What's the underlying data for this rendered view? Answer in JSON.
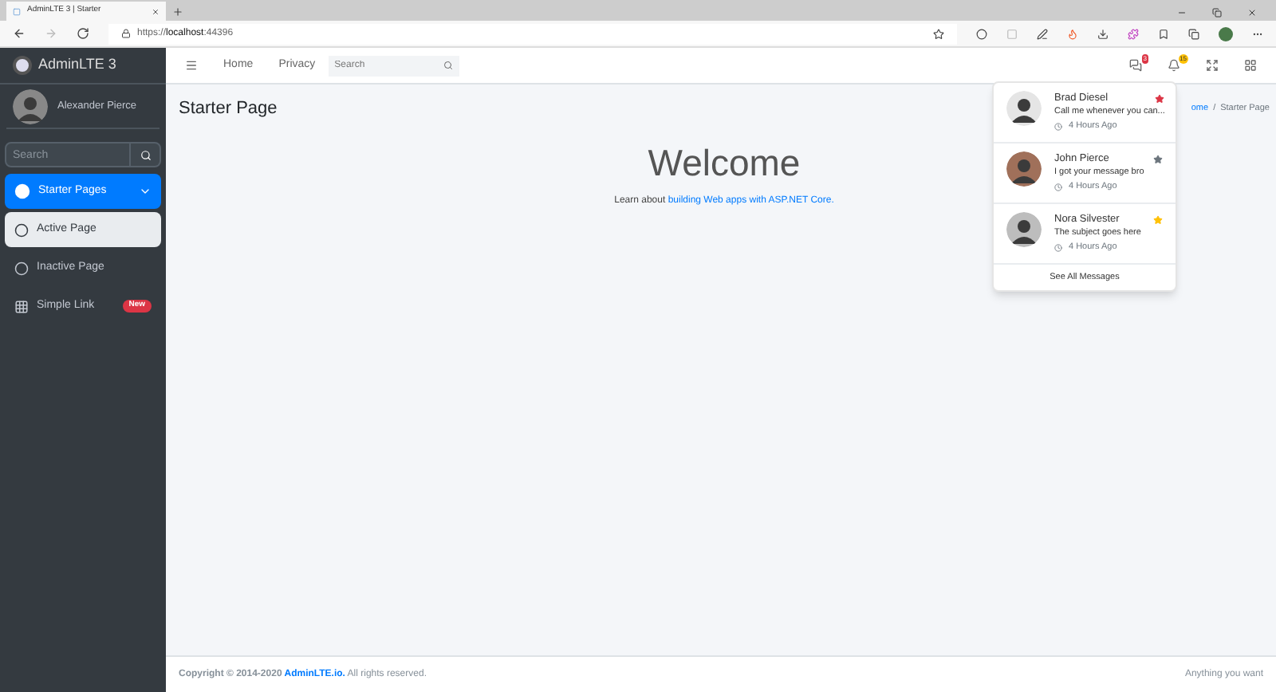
{
  "browser": {
    "tab_title": "AdminLTE 3 | Starter",
    "url_prefix": "https://",
    "url_host": "localhost",
    "url_port": ":44396"
  },
  "brand": {
    "name": "AdminLTE 3"
  },
  "user": {
    "name": "Alexander Pierce"
  },
  "sidebar": {
    "search": {
      "placeholder": "Search"
    },
    "items": [
      {
        "label": "Starter Pages",
        "kind": "menu",
        "selected": true,
        "expanded": true,
        "children": [
          {
            "label": "Active Page",
            "kind": "page",
            "selected": true
          },
          {
            "label": "Inactive Page",
            "kind": "page",
            "selected": false
          }
        ]
      },
      {
        "label": "Simple Link",
        "kind": "link",
        "selected": false,
        "badge": "New"
      }
    ]
  },
  "navbar": {
    "links": [
      "Home",
      "Privacy"
    ],
    "search": {
      "placeholder": "Search"
    },
    "messages_badge": "3",
    "notifications_badge": "15"
  },
  "content": {
    "title": "Starter Page",
    "breadcrumb_separator": "/",
    "breadcrumb": [
      {
        "label": "ome",
        "link": true
      },
      {
        "label": "Starter Page",
        "link": false
      }
    ],
    "heading": "Welcome",
    "lead": "Learn about",
    "lead_link": "building Web apps with ASP.NET Core."
  },
  "messages": {
    "items": [
      {
        "name": "Brad Diesel",
        "text": "Call me whenever you can...",
        "time": "4 Hours Ago",
        "color": "#dc3545"
      },
      {
        "name": "John Pierce",
        "text": "I got your message bro",
        "time": "4 Hours Ago",
        "color": "#6c757d"
      },
      {
        "name": "Nora Silvester",
        "text": "The subject goes here",
        "time": "4 Hours Ago",
        "color": "#ffc107"
      }
    ],
    "footer": "See All Messages"
  },
  "footer": {
    "copyright": "Copyright © 2014-2020",
    "brand_link": "AdminLTE.io.",
    "rights": "All rights reserved.",
    "right_text": "Anything you want"
  }
}
